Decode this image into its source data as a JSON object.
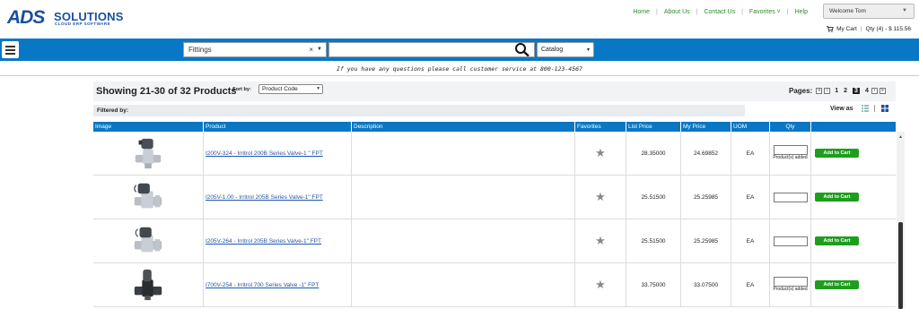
{
  "brand": {
    "logo_main": "ADS",
    "logo_word": "SOLUTIONS",
    "logo_sub": "CLOUD ERP SOFTWARE",
    "color": "#1a4f9c"
  },
  "topnav": [
    "Home",
    "About Us",
    "Contact Us",
    "Favorites",
    "Help"
  ],
  "user": {
    "welcome": "Welcome Tom"
  },
  "cart": {
    "label": "My Cart",
    "summary": "Qty (4) - $ 115.56"
  },
  "search": {
    "category": "Fittings",
    "clear": "×",
    "query": "",
    "scope": "Catalog"
  },
  "notice": "If you have any questions please call customer service at 800-123-4567",
  "listing": {
    "showing": "Showing 21-30 of 32 Products",
    "sort_label": "Sort by:",
    "sort_value": "Product Code",
    "pages_label": "Pages:",
    "pages": [
      "1",
      "2",
      "3",
      "4"
    ],
    "current_page": "3",
    "filtered_by": "Filtered by:",
    "view_as": "View as"
  },
  "columns": [
    "Image",
    "Product",
    "Description",
    "Favorites",
    "List Price",
    "My Price",
    "UOM",
    "Qty",
    ""
  ],
  "rows": [
    {
      "product": "I200V-324 - Irritrol 200B Series Valve-1 \" FPT",
      "list_price": "28.35000",
      "my_price": "24.69852",
      "uom": "EA",
      "qty_note": "Product(s) added",
      "button": "Add to Cart"
    },
    {
      "product": "I205V-1.00 - Irritrol 205B Series Valve-1\" FPT",
      "list_price": "25.51500",
      "my_price": "25.25985",
      "uom": "EA",
      "qty_note": "",
      "button": "Add to Cart"
    },
    {
      "product": "I205V-264 - Irritrol 205B Series Valve-1\" FPT",
      "list_price": "25.51500",
      "my_price": "25.25985",
      "uom": "EA",
      "qty_note": "",
      "button": "Add to Cart"
    },
    {
      "product": "I700V-254 - Irritrol 700 Series Valve -1\" FPT",
      "list_price": "33.75000",
      "my_price": "33.07500",
      "uom": "EA",
      "qty_note": "Product(s) added",
      "button": "Add to Cart"
    }
  ],
  "colors": {
    "accent_blue": "#0877c6",
    "nav_green": "#2e8b2e",
    "button_green": "#1e9e1e"
  }
}
